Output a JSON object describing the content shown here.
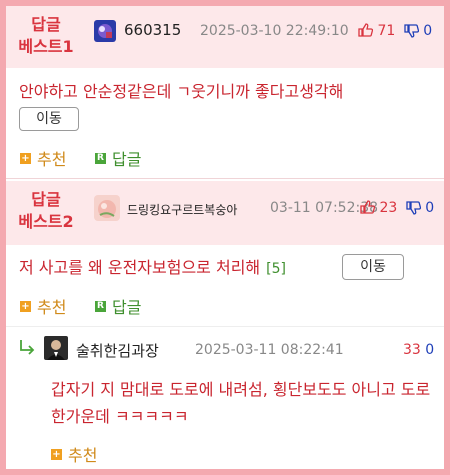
{
  "comments": [
    {
      "badge_line1": "답글",
      "badge_line2": "베스트1",
      "nickname": "660315",
      "date": "2025-03-10 22:49:10",
      "up": "71",
      "down": "0",
      "text": "안야하고 안순정같은데 ㄱ웃기니까 좋다고생각해",
      "move_label": "이동",
      "recommend_label": "추천",
      "reply_label": "답글"
    },
    {
      "badge_line1": "답글",
      "badge_line2": "베스트2",
      "nickname": "드링킹요구르트복숭아",
      "date": "03-11 07:52:38",
      "up": "23",
      "down": "0",
      "text": "저 사고를 왜 운전자보험으로 처리해",
      "reply_count": "[5]",
      "move_label": "이동",
      "recommend_label": "추천",
      "reply_label": "답글"
    },
    {
      "nickname": "술취한김과장",
      "date": "2025-03-11 08:22:41",
      "up": "33",
      "down": "0",
      "text": "갑자기 지 맘대로 도로에 내려섬, 횡단보도도 아니고 도로 한가운데 ㅋㅋㅋㅋㅋ",
      "recommend_label": "추천"
    }
  ],
  "icons": {
    "thumb_up": "thumbs-up-icon",
    "thumb_down": "thumbs-down-icon",
    "reply_arrow": "reply-arrow-icon",
    "recommend": "plus-square-icon",
    "reply": "reply-square-icon"
  },
  "colors": {
    "accent_red": "#d9343f",
    "header_bg": "#fde8ea",
    "border_pink": "#f4a9b0",
    "down_blue": "#1f3fb8",
    "recommend_orange": "#f0a020",
    "reply_green": "#4aa53a"
  }
}
